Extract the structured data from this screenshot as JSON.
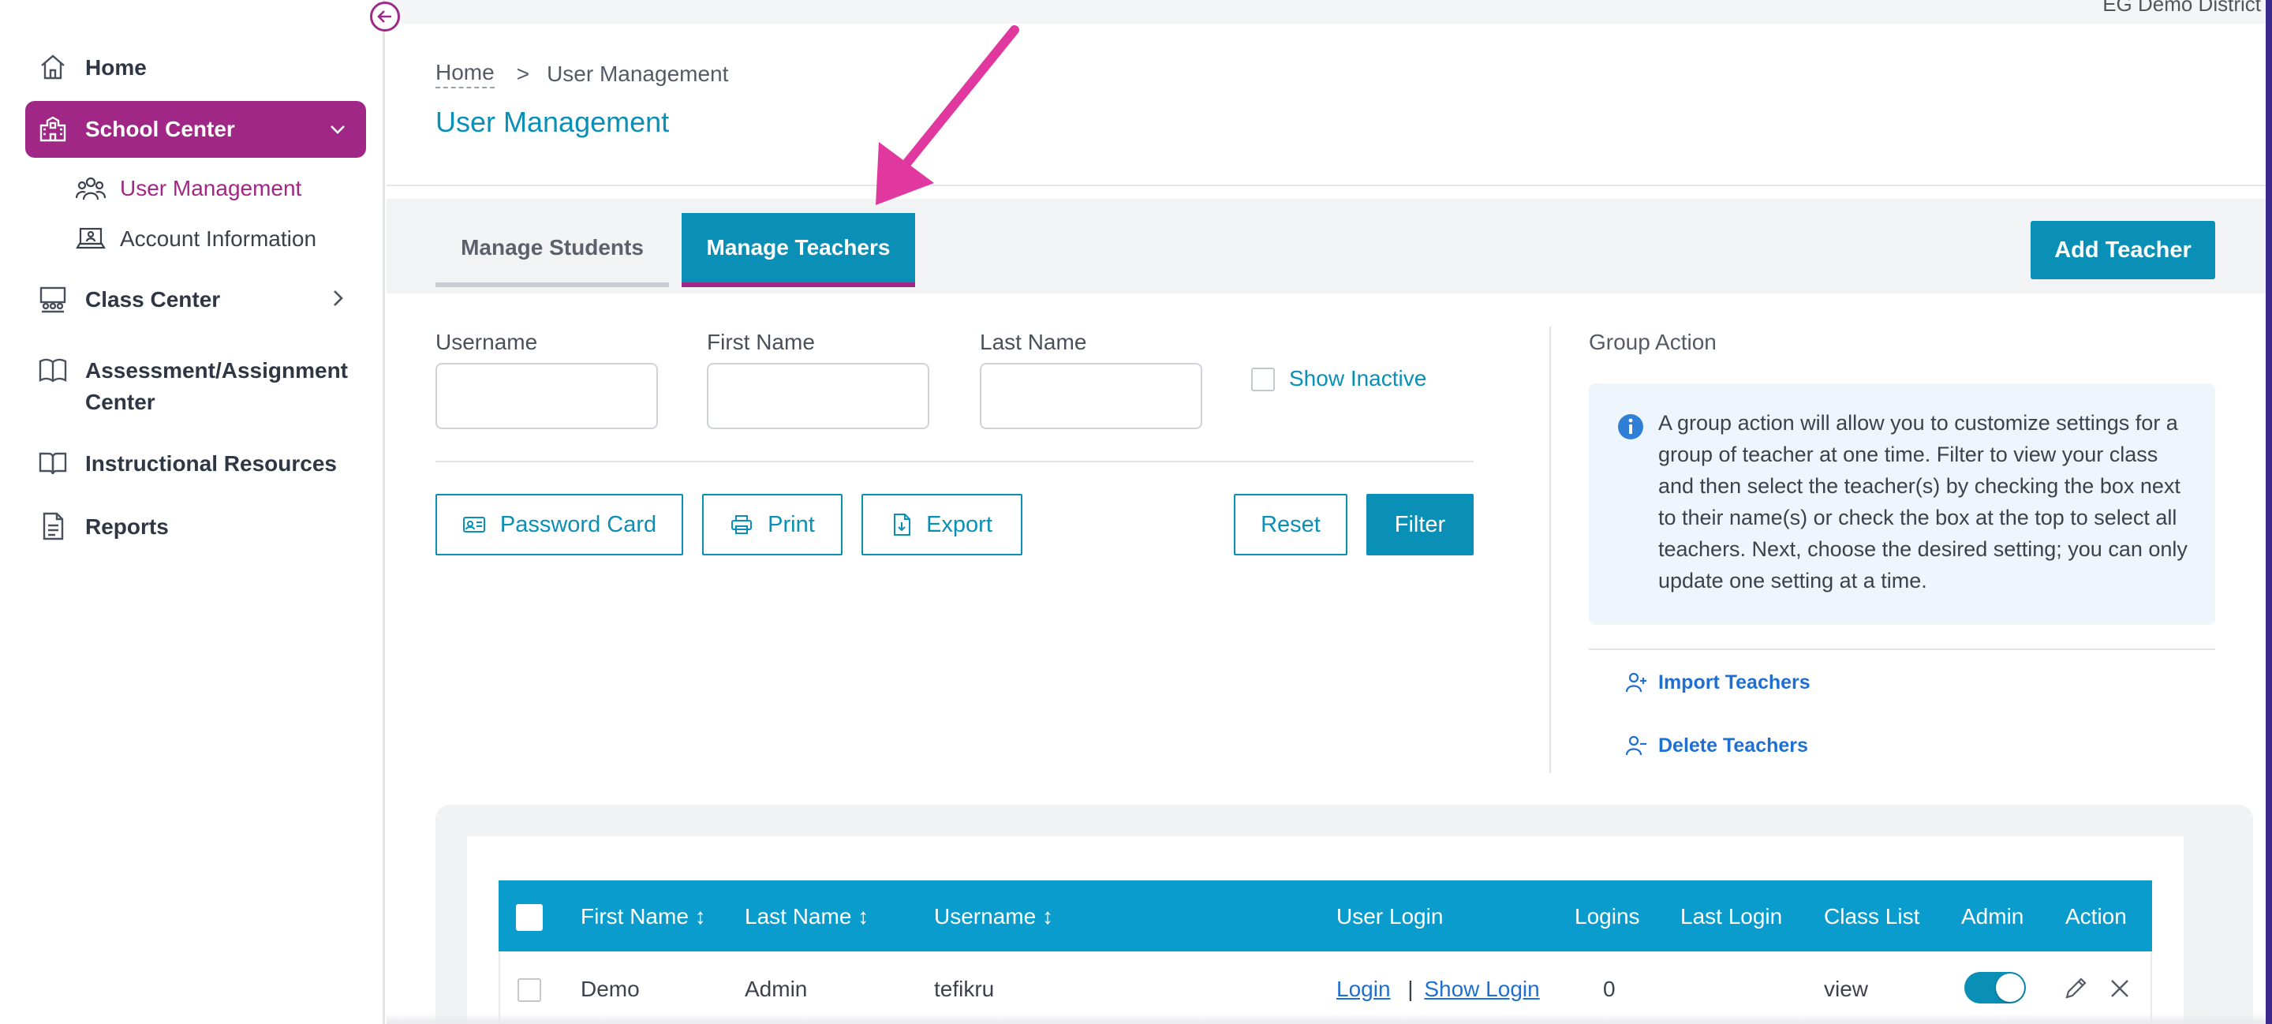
{
  "district_name": "EG Demo District",
  "sidebar": {
    "items": [
      {
        "label": "Home",
        "icon": "home-icon"
      },
      {
        "label": "School Center",
        "icon": "school-icon",
        "active": true
      },
      {
        "label": "Class Center",
        "icon": "classroom-icon"
      },
      {
        "label": "Assessment/Assignment",
        "label2": "Center",
        "icon": "book-icon"
      },
      {
        "label": "Instructional Resources",
        "icon": "open-book-icon"
      },
      {
        "label": "Reports",
        "icon": "report-icon"
      }
    ],
    "subitems": [
      {
        "label": "User Management",
        "icon": "users-icon",
        "active": true
      },
      {
        "label": "Account Information",
        "icon": "laptop-icon"
      }
    ]
  },
  "breadcrumb": {
    "home": "Home",
    "separator": ">",
    "current": "User Management"
  },
  "page_title": "User Management",
  "tabs": [
    {
      "label": "Manage Students"
    },
    {
      "label": "Manage Teachers",
      "active": true
    }
  ],
  "add_teacher_label": "Add Teacher",
  "filters": {
    "username_label": "Username",
    "first_name_label": "First Name",
    "last_name_label": "Last Name",
    "show_inactive_label": "Show Inactive",
    "username_value": "",
    "first_name_value": "",
    "last_name_value": ""
  },
  "buttons": {
    "password_card": "Password Card",
    "print": "Print",
    "export": "Export",
    "reset": "Reset",
    "filter": "Filter"
  },
  "group_action": {
    "title": "Group Action",
    "info": "A group action will allow you to customize settings for a group of teacher at one time. Filter to view your class and then select the teacher(s) by checking the box next to their name(s) or check the box at the top to select all teachers. Next, choose the desired setting; you can only update one setting at a time.",
    "import_label": "Import Teachers",
    "delete_label": "Delete Teachers"
  },
  "table": {
    "columns": [
      "First Name",
      "Last Name",
      "Username",
      "User Login",
      "Logins",
      "Last Login",
      "Class List",
      "Admin",
      "Action"
    ],
    "sort_glyph": "↕",
    "rows": [
      {
        "first_name": "Demo",
        "last_name": "Admin",
        "username": "tefikru",
        "login_link": "Login",
        "login_separator": "|",
        "show_login_link": "Show Login",
        "logins": "0",
        "last_login": "",
        "class_list": "view",
        "admin": true
      }
    ]
  },
  "colors": {
    "brand_magenta": "#a02785",
    "accent_teal": "#0a8fb6",
    "table_header": "#0a9ccc",
    "link_blue": "#1f6fd1",
    "annotation_arrow": "#e0389f"
  }
}
